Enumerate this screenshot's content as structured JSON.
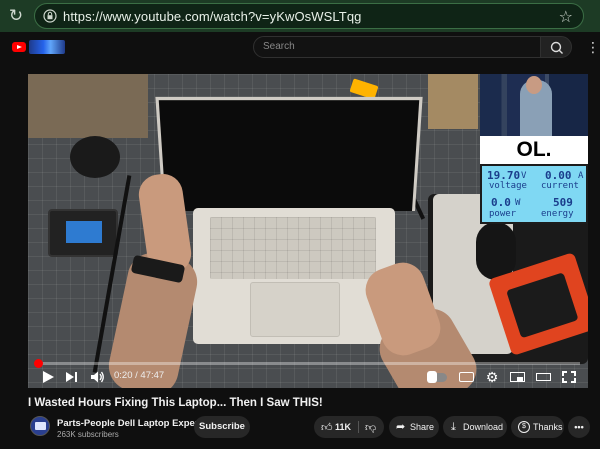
{
  "browser": {
    "url": "https://www.youtube.com/watch?v=yKwOsWSLTqg"
  },
  "header": {
    "search_placeholder": "Search"
  },
  "video": {
    "overlay_ol_text": "OL.",
    "lcd": {
      "voltage_value": "19.70",
      "voltage_unit": "V",
      "current_value": "0.00",
      "current_unit": "A",
      "power_value": "0.0",
      "power_unit": "W",
      "energy_value": "509",
      "label_voltage": "voltage",
      "label_current": "current",
      "label_power": "power",
      "label_energy": "energy"
    },
    "progress_fraction": 0.0042,
    "time_display": "0:20 / 47:47"
  },
  "meta": {
    "title": "I Wasted Hours Fixing This Laptop... Then I Saw THIS!",
    "channel_name": "Parts-People Dell Laptop Experts",
    "subscribers": "263K subscribers",
    "subscribe_label": "Subscribe",
    "like_count": "11K",
    "share_label": "Share",
    "download_label": "Download",
    "thanks_label": "Thanks",
    "more_label": "•••"
  },
  "icons": {
    "reload": "reload-icon",
    "lock": "lock-icon",
    "star": "star-icon",
    "search": "search-icon",
    "play": "play-icon",
    "next": "next-icon",
    "volume": "volume-icon",
    "autoplay": "autoplay-toggle-icon",
    "captions": "captions-icon",
    "settings": "gear-icon",
    "miniplayer": "miniplayer-icon",
    "theater": "theater-icon",
    "fullscreen": "fullscreen-icon",
    "like": "thumbs-up-icon",
    "dislike": "thumbs-down-icon",
    "share": "share-icon",
    "download": "download-icon",
    "thanks": "thanks-icon"
  },
  "colors": {
    "browser_bar": "#1d3b25",
    "brand_red": "#ff0000",
    "page_bg": "#0f0f0f",
    "pill_bg": "#272727"
  }
}
